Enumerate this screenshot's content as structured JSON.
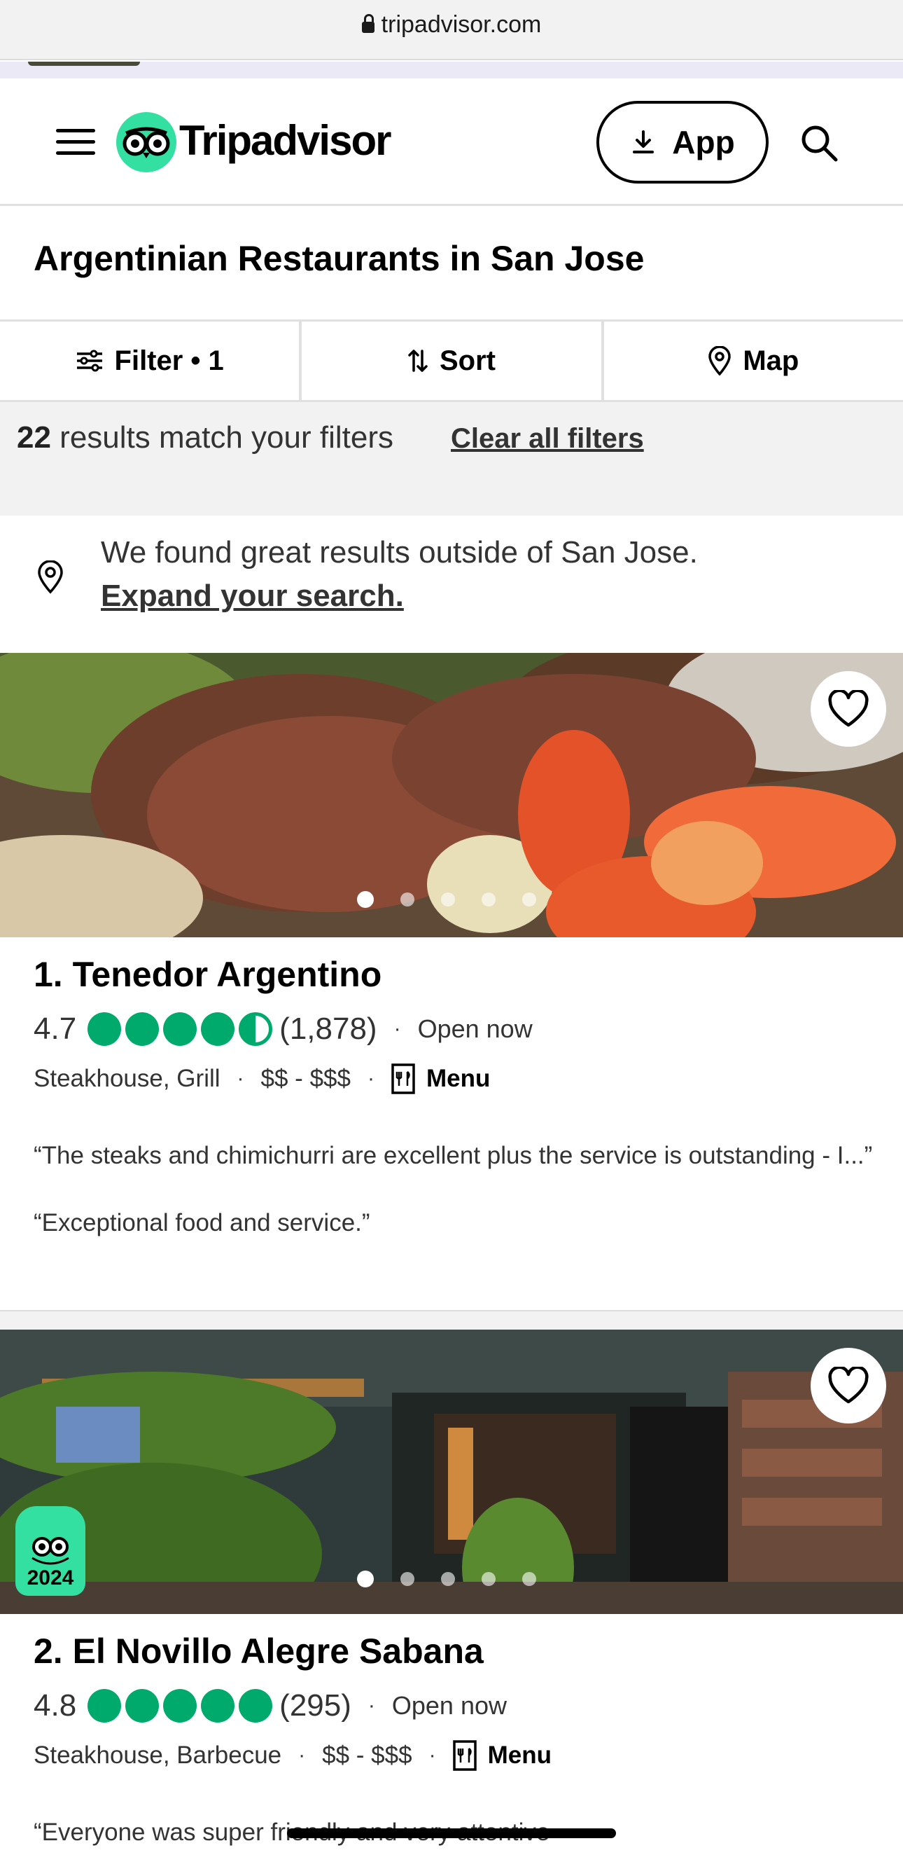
{
  "browser": {
    "url": "tripadvisor.com"
  },
  "header": {
    "brand": "Tripadvisor",
    "app_label": "App"
  },
  "page": {
    "title": "Argentinian Restaurants in San Jose"
  },
  "toolbar": {
    "filter_label": "Filter • 1",
    "sort_label": "Sort",
    "map_label": "Map"
  },
  "results": {
    "count": "22",
    "text": " results match your filters",
    "clear_label": "Clear all filters"
  },
  "expand": {
    "line1": "We found great results outside of San Jose.",
    "line2": "Expand your search."
  },
  "cards": [
    {
      "name": "1. Tenedor Argentino",
      "rating": "4.7",
      "bubbles": 4.5,
      "reviews": "(1,878)",
      "status": "Open now",
      "categories": "Steakhouse, Grill",
      "price": "$$ - $$$",
      "menu_label": "Menu",
      "review1": "“The steaks and chimichurri are excellent plus the service is outstanding - I...”",
      "review2": "“Exceptional food and service.”"
    },
    {
      "name": "2. El Novillo Alegre Sabana",
      "rating": "4.8",
      "bubbles": 5,
      "reviews": "(295)",
      "status": "Open now",
      "categories": "Steakhouse, Barbecue",
      "price": "$$ - $$$",
      "menu_label": "Menu",
      "award_year": "2024",
      "review1": "“Everyone was super friendly and very attentive"
    }
  ],
  "icons": [
    "lock-icon",
    "hamburger-icon",
    "owl-logo-icon",
    "download-icon",
    "search-icon",
    "filter-icon",
    "sort-icon",
    "map-pin-icon",
    "heart-icon",
    "menu-icon"
  ],
  "colors": {
    "brand_green": "#34e0a1",
    "bubble_green": "#00aa6c"
  }
}
